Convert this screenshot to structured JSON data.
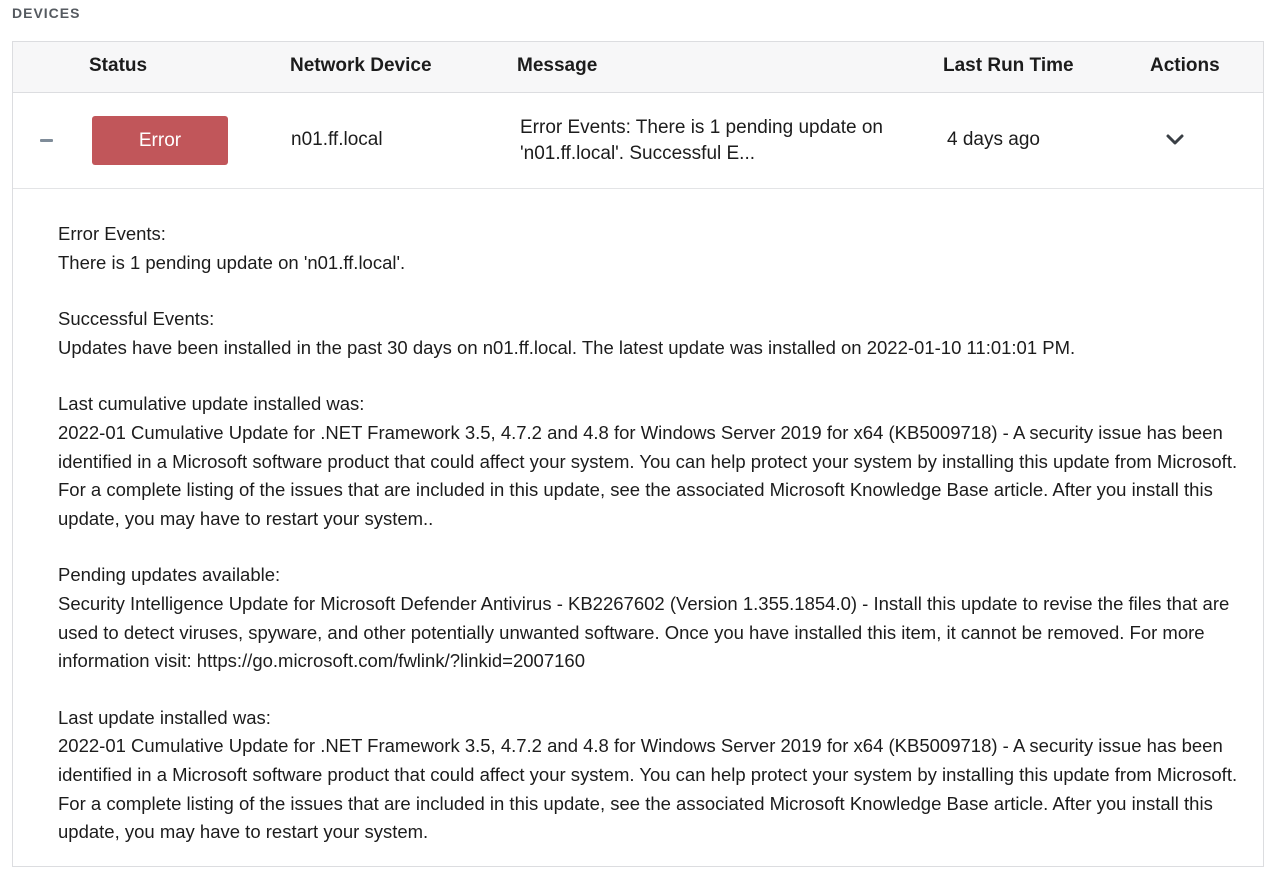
{
  "section": {
    "label": "DEVICES"
  },
  "table": {
    "headers": {
      "status": "Status",
      "device": "Network Device",
      "message": "Message",
      "last_run": "Last Run Time",
      "actions": "Actions"
    },
    "row": {
      "status": "Error",
      "status_color": "#c1565a",
      "device": "n01.ff.local",
      "message": "Error Events: There is 1 pending update on 'n01.ff.local'. Successful E...",
      "last_run": "4 days ago",
      "toggle_icon": "minus-icon",
      "action_icon": "chevron-down-icon"
    }
  },
  "details": {
    "error_heading": "Error Events:",
    "error_text": "There is 1 pending update on 'n01.ff.local'.",
    "success_heading": "Successful Events:",
    "success_text": "Updates have been installed in the past 30 days on n01.ff.local. The latest update was installed on 2022-01-10 11:01:01 PM.",
    "cumulative_heading": "Last cumulative update installed was:",
    "cumulative_text": "2022-01 Cumulative Update for .NET Framework 3.5, 4.7.2 and 4.8 for Windows Server 2019 for x64 (KB5009718) - A security issue has been identified in a Microsoft software product that could affect your system. You can help protect your system by installing this update from Microsoft. For a complete listing of the issues that are included in this update, see the associated Microsoft Knowledge Base article. After you install this update, you may have to restart your system..",
    "pending_heading": "Pending updates available:",
    "pending_text": "Security Intelligence Update for Microsoft Defender Antivirus - KB2267602 (Version 1.355.1854.0) - Install this update to revise the files that are used to detect viruses, spyware, and other potentially unwanted software. Once you have installed this item, it cannot be removed. For more information visit: https://go.microsoft.com/fwlink/?linkid=2007160",
    "last_update_heading": "Last update installed was:",
    "last_update_text": "2022-01 Cumulative Update for .NET Framework 3.5, 4.7.2 and 4.8 for Windows Server 2019 for x64 (KB5009718) - A security issue has been identified in a Microsoft software product that could affect your system. You can help protect your system by installing this update from Microsoft. For a complete listing of the issues that are included in this update, see the associated Microsoft Knowledge Base article. After you install this update, you may have to restart your system."
  }
}
